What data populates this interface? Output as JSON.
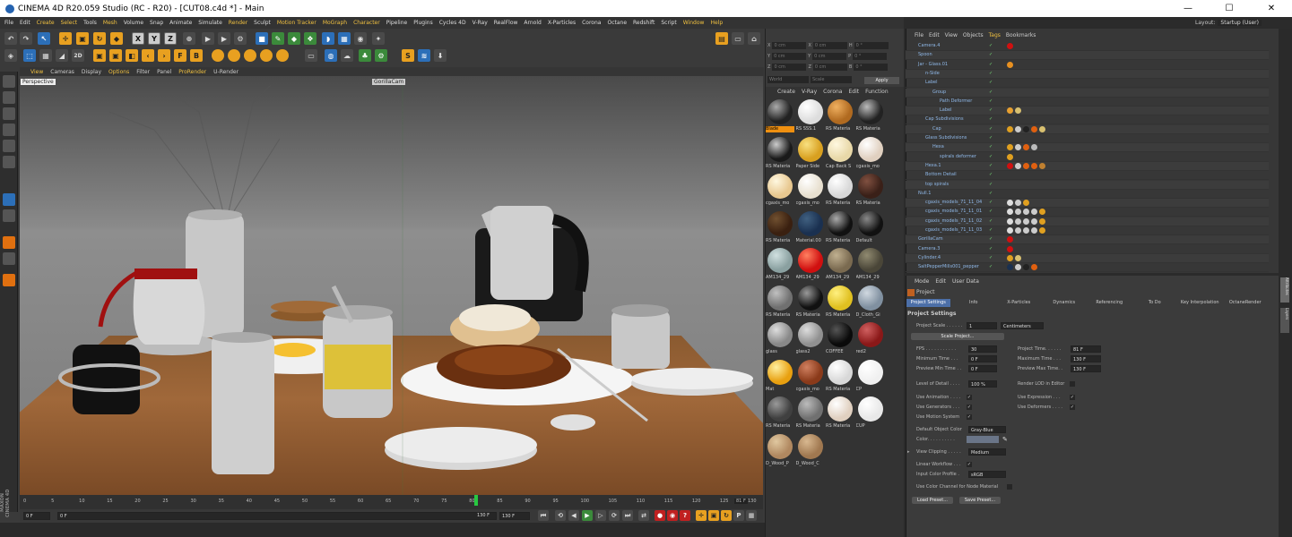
{
  "window": {
    "title": "CINEMA 4D R20.059 Studio (RC - R20) - [CUT08.c4d *] - Main",
    "minimize": "—",
    "maximize": "☐",
    "close": "✕"
  },
  "menu": [
    "File",
    "Edit",
    "Create",
    "Select",
    "Tools",
    "Mesh",
    "Volume",
    "Snap",
    "Animate",
    "Simulate",
    "Render",
    "Sculpt",
    "Motion Tracker",
    "MoGraph",
    "Character",
    "Pipeline",
    "Plugins",
    "Cycles 4D",
    "V-Ray",
    "RealFlow",
    "Arnold",
    "X-Particles",
    "Corona",
    "Octane",
    "Redshift",
    "Script",
    "Window",
    "Help"
  ],
  "menu_highlight": [
    "Create",
    "Select",
    "Mesh",
    "Render",
    "Motion Tracker",
    "MoGraph",
    "Character",
    "Window",
    "Help"
  ],
  "layout": {
    "label": "Layout:",
    "value": "Startup (User)"
  },
  "toolbar": {
    "x": "X",
    "y": "Y",
    "z": "Z",
    "f": "F",
    "b": "B",
    "twod": "2D"
  },
  "viewport_menu": [
    "View",
    "Cameras",
    "Display",
    "Options",
    "Filter",
    "Panel",
    "ProRender",
    "U-Render"
  ],
  "viewport_menu_highlight": [
    "View",
    "Options",
    "ProRender"
  ],
  "viewport": {
    "perspective": "Perspective",
    "camera": "GorillaCam"
  },
  "timeline": {
    "ticks": [
      "0",
      "5",
      "10",
      "15",
      "20",
      "25",
      "30",
      "35",
      "40",
      "45",
      "50",
      "55",
      "60",
      "65",
      "70",
      "75",
      "80",
      "85",
      "90",
      "95",
      "100",
      "105",
      "110",
      "115",
      "120",
      "125",
      "130"
    ],
    "current": "81 F",
    "start": "0 F",
    "start2": "0 F",
    "end": "130 F",
    "end2": "130 F"
  },
  "maxon": "MAXON CINEMA 4D",
  "coords": {
    "rows": [
      {
        "a": "X",
        "av": "0 cm",
        "b": "X",
        "bv": "0 cm",
        "c": "H",
        "cv": "0 °"
      },
      {
        "a": "Y",
        "av": "0 cm",
        "b": "Y",
        "bv": "0 cm",
        "c": "P",
        "cv": "0 °"
      },
      {
        "a": "Z",
        "av": "0 cm",
        "b": "Z",
        "bv": "0 cm",
        "c": "B",
        "cv": "0 °"
      }
    ],
    "mode1": "World",
    "mode2": "Scale",
    "apply": "Apply"
  },
  "material_menu": [
    "Create",
    "V-Ray",
    "Corona",
    "Edit",
    "Function"
  ],
  "materials": [
    {
      "label": "Blade",
      "color": "#222",
      "hl": "#aaa",
      "sel": true
    },
    {
      "label": "RS SSS.1",
      "color": "#ddd",
      "hl": "#fff"
    },
    {
      "label": "RS Materia",
      "color": "#b06a20",
      "hl": "#f0b060"
    },
    {
      "label": "RS Materia",
      "color": "#222",
      "hl": "#bbb"
    },
    {
      "label": "RS Materia",
      "color": "#1a1a1a",
      "hl": "#ccc"
    },
    {
      "label": "Paper Side",
      "color": "#d8a020",
      "hl": "#f8e080"
    },
    {
      "label": "Cap Back S",
      "color": "#e8d8a8",
      "hl": "#fff8e0"
    },
    {
      "label": "cgaxis_mo",
      "color": "#e0d0c0",
      "hl": "#fff"
    },
    {
      "label": "cgaxis_mo",
      "color": "#e8c890",
      "hl": "#fff8e0"
    },
    {
      "label": "cgaxis_mo",
      "color": "#e8e0d0",
      "hl": "#fff"
    },
    {
      "label": "RS Materia",
      "color": "#d8d8d8",
      "hl": "#fff"
    },
    {
      "label": "RS Materia",
      "color": "#3a2018",
      "hl": "#805040"
    },
    {
      "label": "RS Materia",
      "color": "#3a2010",
      "hl": "#705030"
    },
    {
      "label": "Material.00",
      "color": "#1a3050",
      "hl": "#406080"
    },
    {
      "label": "RS Materia",
      "color": "#111",
      "hl": "#aaa"
    },
    {
      "label": "Default",
      "color": "#111",
      "hl": "#888"
    },
    {
      "label": "AM134_29",
      "color": "#8aa0a0",
      "hl": "#d0e0e0"
    },
    {
      "label": "AM134_29",
      "color": "#d01010",
      "hl": "#ff8060"
    },
    {
      "label": "AM134_29",
      "color": "#7a6a50",
      "hl": "#c0b090"
    },
    {
      "label": "AM134_29",
      "color": "#4a4638",
      "hl": "#908a70"
    },
    {
      "label": "RS Materia",
      "color": "#707070",
      "hl": "#c0c0c0"
    },
    {
      "label": "RS Materia",
      "color": "#111",
      "hl": "#999"
    },
    {
      "label": "RS Materia",
      "color": "#e0c020",
      "hl": "#fff080"
    },
    {
      "label": "D_Cloth_Gi",
      "color": "#8090a0",
      "hl": "#d0d8e0"
    },
    {
      "label": "glass",
      "color": "#888",
      "hl": "#ddd"
    },
    {
      "label": "glass2",
      "color": "#909090",
      "hl": "#ddd"
    },
    {
      "label": "COFFEE",
      "color": "#0a0a0a",
      "hl": "#555"
    },
    {
      "label": "red2",
      "color": "#8a1818",
      "hl": "#d06060"
    },
    {
      "label": "Mat",
      "color": "#e8a010",
      "hl": "#fff0a0"
    },
    {
      "label": "cgaxis_mo",
      "color": "#8a3a1a",
      "hl": "#d08060"
    },
    {
      "label": "RS Materia",
      "color": "#d8d8d8",
      "hl": "#fff"
    },
    {
      "label": "CP",
      "color": "#f0f0f0",
      "hl": "#fff"
    },
    {
      "label": "RS Materia",
      "color": "#404040",
      "hl": "#999"
    },
    {
      "label": "RS Materia",
      "color": "#707070",
      "hl": "#bbb"
    },
    {
      "label": "RS Materia",
      "color": "#e0d0c0",
      "hl": "#fff"
    },
    {
      "label": "CUP",
      "color": "#e8e8e8",
      "hl": "#fff"
    },
    {
      "label": "D_Wood_P",
      "color": "#b08860",
      "hl": "#e0c8a0"
    },
    {
      "label": "D_Wood_C",
      "color": "#a07850",
      "hl": "#d8b890"
    }
  ],
  "object_menu": [
    "File",
    "Edit",
    "View",
    "Objects",
    "Tags",
    "Bookmarks"
  ],
  "object_menu_highlight": [
    "Tags"
  ],
  "objects": [
    {
      "name": "Camera.4",
      "indent": 0,
      "tags": [
        "#d01010"
      ]
    },
    {
      "name": "Spoon",
      "indent": 0,
      "tags": []
    },
    {
      "name": "Jar - Glass.01",
      "indent": 0,
      "tags": [
        "#e89020"
      ]
    },
    {
      "name": "n-Side",
      "indent": 1,
      "tags": []
    },
    {
      "name": "Label",
      "indent": 1,
      "tags": []
    },
    {
      "name": "Group",
      "indent": 2,
      "tags": []
    },
    {
      "name": "Path Deformer",
      "indent": 3,
      "tags": []
    },
    {
      "name": "Label",
      "indent": 3,
      "tags": [
        "#e8a030",
        "#d8c070"
      ]
    },
    {
      "name": "Cap Subdivisions",
      "indent": 1,
      "tags": []
    },
    {
      "name": "Cap",
      "indent": 2,
      "tags": [
        "#e0a020",
        "#ccc",
        "#222",
        "#e06010",
        "#d8c070"
      ]
    },
    {
      "name": "Glass Subdivisions",
      "indent": 1,
      "tags": []
    },
    {
      "name": "Hexa",
      "indent": 2,
      "tags": [
        "#e0a020",
        "#ccc",
        "#e06010",
        "#bbb"
      ]
    },
    {
      "name": "spirals deformer",
      "indent": 3,
      "tags": [
        "#e0a020"
      ]
    },
    {
      "name": "Hexa.1",
      "indent": 1,
      "tags": [
        "#d01010",
        "#ccc",
        "#e06010",
        "#e06010",
        "#c08030"
      ]
    },
    {
      "name": "Bottom Detail",
      "indent": 1,
      "tags": []
    },
    {
      "name": "top spirals",
      "indent": 1,
      "tags": []
    },
    {
      "name": "Null.1",
      "indent": 0,
      "tags": []
    },
    {
      "name": "cgaxis_models_71_11_04",
      "indent": 1,
      "tags": [
        "#ddd",
        "#ccc",
        "#e0a020"
      ]
    },
    {
      "name": "cgaxis_models_71_11_01",
      "indent": 1,
      "tags": [
        "#ddd",
        "#ccc",
        "#ccc",
        "#ccc",
        "#e0a020"
      ]
    },
    {
      "name": "cgaxis_models_71_11_02",
      "indent": 1,
      "tags": [
        "#ddd",
        "#ccc",
        "#ccc",
        "#ccc",
        "#e0a020"
      ]
    },
    {
      "name": "cgaxis_models_71_11_03",
      "indent": 1,
      "tags": [
        "#ddd",
        "#ccc",
        "#ccc",
        "#ccc",
        "#e0a020"
      ]
    },
    {
      "name": "GorillaCam",
      "indent": 0,
      "tags": [
        "#d01010"
      ]
    },
    {
      "name": "Camera.3",
      "indent": 0,
      "tags": [
        "#d01010"
      ]
    },
    {
      "name": "Cylinder.4",
      "indent": 0,
      "tags": [
        "#e0a020",
        "#d8c070"
      ]
    },
    {
      "name": "SaltPepperMills001_pepper",
      "indent": 0,
      "tags": [
        "#1a3050",
        "#ccc",
        "#222",
        "#e06010"
      ]
    }
  ],
  "attr_menu": [
    "Mode",
    "Edit",
    "User Data"
  ],
  "attr_title": "Project",
  "attr_tabs": [
    "Project Settings",
    "Info",
    "X-Particles",
    "Dynamics",
    "Referencing",
    "To Do",
    "Key Interpolation",
    "OctaneRender"
  ],
  "project_settings": {
    "header": "Project Settings",
    "scale_label": "Project Scale . . . . . .",
    "scale_val": "1",
    "scale_unit": "Centimeters",
    "scale_btn": "Scale Project...",
    "fps_label": "FPS . . . . . . . . . . .",
    "fps": "30",
    "min_label": "Minimum Time . . .",
    "min": "0 F",
    "prevmin_label": "Preview Min Time . .",
    "prevmin": "0 F",
    "ptime_label": "Project Time. . . . . .",
    "ptime": "81 F",
    "max_label": "Maximum Time . . .",
    "max": "130 F",
    "prevmax_label": "Preview Max Time. .",
    "prevmax": "130 F",
    "lod_label": "Level of Detail . . . .",
    "lod": "100 %",
    "rlod_label": "Render LOD in Editor",
    "anim_label": "Use Animation . . . .",
    "expr_label": "Use Expression . . .",
    "gen_label": "Use Generators . . .",
    "def_label": "Use Deformers . . . .",
    "ms_label": "Use Motion System",
    "doc_label": "Default Object Color",
    "doc": "Gray-Blue",
    "col_label": "Color. . . . . . . . . .",
    "clip_label": "View Clipping . . . . .",
    "clip": "Medium",
    "lin_label": "Linear Workflow . . .",
    "icp_label": "Input Color Profile .",
    "icp": "sRGB",
    "cc_label": "Use Color Channel for Node Material",
    "load": "Load Preset...",
    "save": "Save Preset..."
  },
  "rightstrip": [
    "Attributes",
    "Layers"
  ],
  "check": "✓"
}
